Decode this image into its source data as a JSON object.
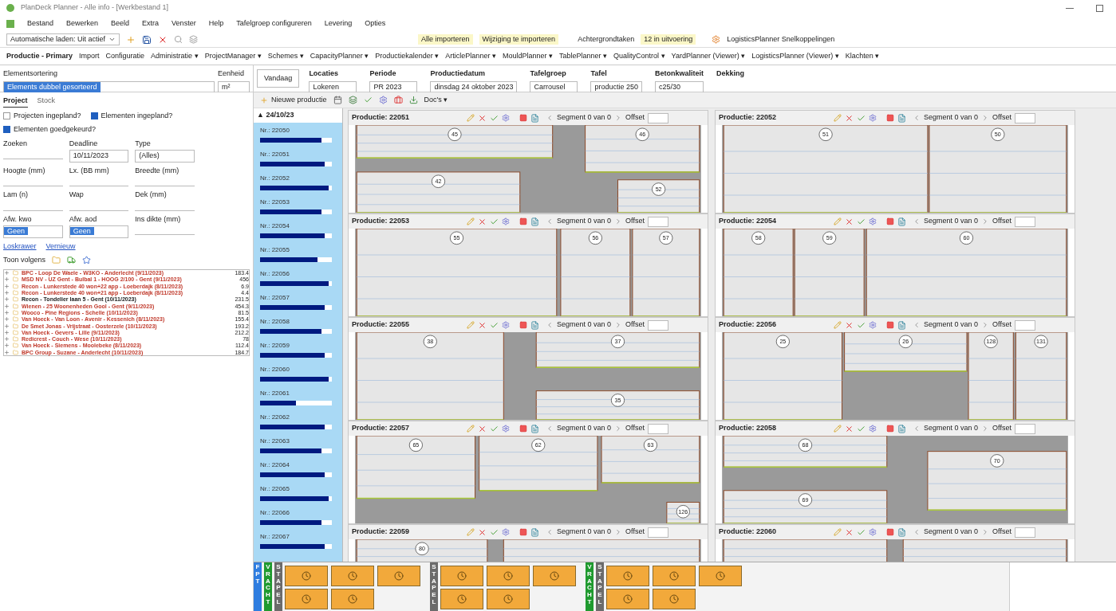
{
  "window": {
    "title": "PlanDeck Planner - Alle info - [Werkbestand 1]"
  },
  "menu": [
    "Bestand",
    "Bewerken",
    "Beeld",
    "Extra",
    "Venster",
    "Help",
    "Tafelgroep configureren",
    "Levering",
    "Opties"
  ],
  "toolbar": {
    "autoload": "Automatische laden: Uit actief",
    "import_all": "Alle importeren",
    "changes": "Wijziging te importeren",
    "background_tasks": "Achtergrondtaken",
    "running": "12 in uitvoering",
    "shortcuts": "LogisticsPlanner Snelkoppelingen"
  },
  "nav": [
    {
      "label": "Productie - Primary"
    },
    {
      "label": "Import"
    },
    {
      "label": "Configuratie"
    },
    {
      "label": "Administratie",
      "arrow": "▾"
    },
    {
      "label": "ProjectManager",
      "arrow": "▾"
    },
    {
      "label": "Schemes",
      "arrow": "▾"
    },
    {
      "label": "CapacityPlanner",
      "arrow": "▾"
    },
    {
      "label": "Productiekalender",
      "arrow": "▾"
    },
    {
      "label": "ArticlePlanner",
      "arrow": "▾"
    },
    {
      "label": "MouldPlanner",
      "arrow": "▾"
    },
    {
      "label": "TablePlanner",
      "arrow": "▾"
    },
    {
      "label": "QualityControl",
      "arrow": "▾"
    },
    {
      "label": "YardPlanner (Viewer)",
      "arrow": "▾"
    },
    {
      "label": "LogisticsPlanner (Viewer)",
      "arrow": "▾"
    },
    {
      "label": "Klachten",
      "arrow": "▾"
    }
  ],
  "filters": {
    "sort_label": "Elementsortering",
    "sort_value": "Elements dubbel gesorteerd",
    "unit_label": "Eenheid",
    "unit_value": "m²",
    "today": "Vandaag",
    "fields": [
      {
        "label": "Locaties",
        "value": "Lokeren"
      },
      {
        "label": "Periode",
        "value": "PR 2023"
      },
      {
        "label": "Productiedatum",
        "value": "dinsdag 24 oktober 2023"
      },
      {
        "label": "Tafelgroep",
        "value": "Carrousel"
      },
      {
        "label": "Tafel",
        "value": "productie 250"
      },
      {
        "label": "Betonkwaliteit",
        "value": "c25/30"
      },
      {
        "label": "Dekking"
      }
    ]
  },
  "left": {
    "tabs": [
      {
        "label": "Project",
        "selected": true
      },
      {
        "label": "Stock",
        "selected": false
      }
    ],
    "checks": [
      {
        "label": "Projecten ingepland?",
        "checked": false
      },
      {
        "label": "Elementen ingepland?",
        "checked": true
      },
      {
        "label": "Elementen goedgekeurd?",
        "checked": true
      }
    ],
    "fields": [
      "Zoeken",
      "Deadline",
      "Type",
      "Hoogte (mm)",
      "Lx. (BB mm)",
      "Breedte (mm)",
      "Lam (n)",
      "Wap",
      "Dek (mm)",
      "Afw. kwo",
      "Afw. aod",
      "Ins dikte (mm)"
    ],
    "deadline_value": "10/11/2023",
    "type_value": "(Alles)",
    "afw_values": [
      "Geen",
      "Geen"
    ],
    "links": [
      "Loskrawer",
      "Vernieuw"
    ],
    "show_label": "Toon volgens",
    "projects": [
      {
        "name": "BPC - Loop De Waele - W3KO - Anderlecht (9/11/2023)",
        "amount": "183.4",
        "color": "#c0392b"
      },
      {
        "name": "MSD NV - UZ Gent - Bulbal 1 - HOOG 2/100 - Gent (9/11/2023)",
        "amount": "456",
        "color": "#c0392b"
      },
      {
        "name": "Recon - Lunkerstede 40 won+22 app - Loeberdajk (8/11/2023)",
        "amount": "6.9",
        "color": "#c0392b"
      },
      {
        "name": "Recon - Lunkerstede 40 won+21 app - Loeberdajk (8/11/2023)",
        "amount": "4.4",
        "color": "#c0392b"
      },
      {
        "name": "Recon - Tondelier laan 5 - Gent (10/11/2023)",
        "amount": "231.5",
        "color": "#222222"
      },
      {
        "name": "Wienen - 25 Woonenheden Gool - Gent (9/11/2023)",
        "amount": "454.3",
        "color": "#c0392b"
      },
      {
        "name": "Wooco - Pine Regions - Schelle (10/11/2023)",
        "amount": "81.5",
        "color": "#c0392b"
      },
      {
        "name": "Van Hoeck - Van Loon - Avenir - Kessenich (8/11/2023)",
        "amount": "155.4",
        "color": "#c0392b"
      },
      {
        "name": "De Smet Jonas - Vrijstraat - Oosterzele (10/11/2023)",
        "amount": "193.2",
        "color": "#c0392b"
      },
      {
        "name": "Van Hoeck - Gevers - Lille (9/11/2023)",
        "amount": "212.2",
        "color": "#c0392b"
      },
      {
        "name": "Redicrest - Couch - Wese (10/11/2023)",
        "amount": "78",
        "color": "#c0392b"
      },
      {
        "name": "Van Hoeck - Siemens - Moolebeke (8/11/2023)",
        "amount": "112.4",
        "color": "#c0392b"
      },
      {
        "name": "BPC Group - Suzane - Anderlecht (10/11/2023)",
        "amount": "184.7",
        "color": "#c0392b"
      }
    ]
  },
  "prod_toolbar": {
    "new": "Nieuwe productie",
    "docs": "Doc's",
    "docs_arrow": "▾"
  },
  "timeline": {
    "marker": "▲",
    "date": "24/10/23",
    "items": [
      {
        "label": "Nr.: 22050",
        "level": 0.85
      },
      {
        "label": "Nr.: 22051",
        "level": 0.9
      },
      {
        "label": "Nr.: 22052",
        "level": 0.95
      },
      {
        "label": "Nr.: 22053",
        "level": 0.85
      },
      {
        "label": "Nr.: 22054",
        "level": 0.9
      },
      {
        "label": "Nr.: 22055",
        "level": 0.8
      },
      {
        "label": "Nr.: 22056",
        "level": 0.95
      },
      {
        "label": "Nr.: 22057",
        "level": 0.9
      },
      {
        "label": "Nr.: 22058",
        "level": 0.85
      },
      {
        "label": "Nr.: 22059",
        "level": 0.9
      },
      {
        "label": "Nr.: 22060",
        "level": 0.95
      },
      {
        "label": "Nr.: 22061",
        "level": 0.5
      },
      {
        "label": "Nr.: 22062",
        "level": 0.9
      },
      {
        "label": "Nr.: 22063",
        "level": 0.85
      },
      {
        "label": "Nr.: 22064",
        "level": 0.9
      },
      {
        "label": "Nr.: 22065",
        "level": 0.95
      },
      {
        "label": "Nr.: 22066",
        "level": 0.85
      },
      {
        "label": "Nr.: 22067",
        "level": 0.9
      }
    ]
  },
  "productions": [
    {
      "title": "Productie: 22051",
      "segment": "Segment 0 van 0",
      "offset": "Offset",
      "slabs": [
        "45",
        "46",
        "42",
        "52"
      ]
    },
    {
      "title": "Productie: 22052",
      "segment": "Segment 0 van 0",
      "offset": "Offset",
      "slabs": [
        "51",
        "50"
      ]
    },
    {
      "title": "Productie: 22053",
      "segment": "Segment 0 van 0",
      "offset": "Offset",
      "slabs": [
        "55",
        "56",
        "57"
      ]
    },
    {
      "title": "Productie: 22054",
      "segment": "Segment 0 van 0",
      "offset": "Offset",
      "slabs": [
        "58",
        "59",
        "60"
      ]
    },
    {
      "title": "Productie: 22055",
      "segment": "Segment 0 van 0",
      "offset": "Offset",
      "slabs": [
        "38",
        "37",
        "35"
      ]
    },
    {
      "title": "Productie: 22056",
      "segment": "Segment 0 van 0",
      "offset": "Offset",
      "slabs": [
        "25",
        "26",
        "128",
        "131"
      ]
    },
    {
      "title": "Productie: 22057",
      "segment": "Segment 0 van 0",
      "offset": "Offset",
      "slabs": [
        "65",
        "62",
        "63",
        "126"
      ]
    },
    {
      "title": "Productie: 22058",
      "segment": "Segment 0 van 0",
      "offset": "Offset",
      "slabs": [
        "68",
        "69",
        "70"
      ]
    },
    {
      "title": "Productie: 22059",
      "segment": "Segment 0 van 0",
      "offset": "Offset",
      "slabs": [
        "80"
      ]
    },
    {
      "title": "Productie: 22060",
      "segment": "Segment 0 van 0",
      "offset": "Offset"
    }
  ],
  "bottom": {
    "groups": [
      {
        "labels": [
          {
            "text": "FPT",
            "kind": "blue"
          },
          {
            "text": "VRACHT",
            "kind": "green"
          },
          {
            "text": "STAPEL",
            "kind": "gray"
          }
        ]
      },
      {
        "labels": [
          {
            "text": "STAPEL",
            "kind": "gray"
          }
        ]
      },
      {
        "labels": [
          {
            "text": "VRACHT",
            "kind": "green"
          },
          {
            "text": "STAPEL",
            "kind": "gray"
          }
        ]
      }
    ]
  }
}
